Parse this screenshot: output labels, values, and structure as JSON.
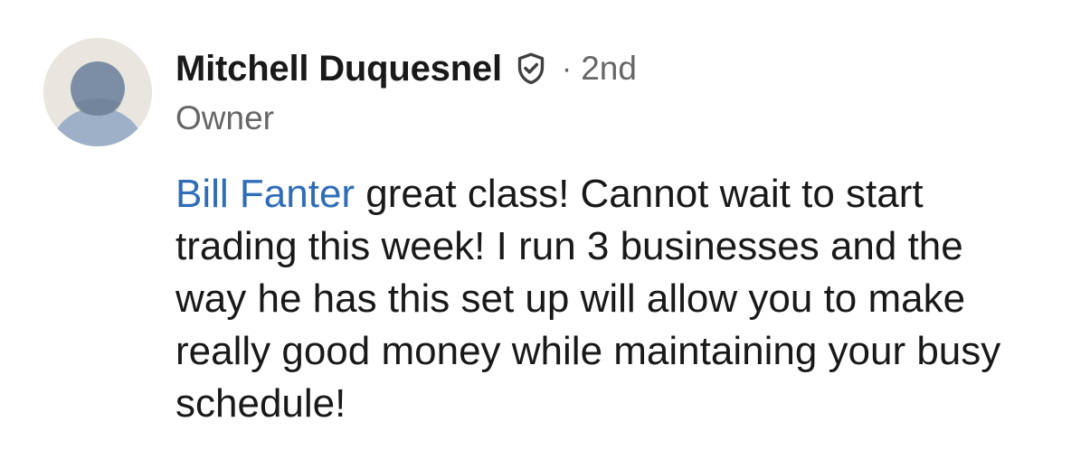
{
  "comment": {
    "author": {
      "name": "Mitchell Duquesnel",
      "verified_icon": "verified-shield-icon",
      "separator": "·",
      "degree": "2nd",
      "headline": "Owner",
      "avatar_icon": "default-person-avatar"
    },
    "mention": "Bill Fanter",
    "text": " great class! Cannot wait to start trading this week! I run 3 businesses and the way he has this set up will allow you to make really good money while maintaining your busy schedule!"
  },
  "colors": {
    "mention": "#2f6db8",
    "text": "#191919",
    "secondary_text": "#666666",
    "avatar_bg": "#e9e5df",
    "avatar_figure": "#9db0c7",
    "avatar_head": "#7c8ea6"
  }
}
